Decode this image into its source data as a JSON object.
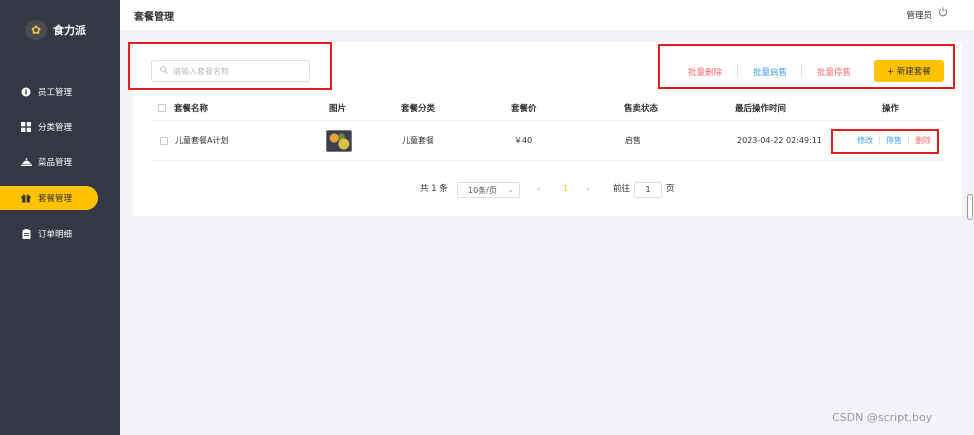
{
  "sidebar": {
    "logo_text": "食力派",
    "items": [
      {
        "label": "员工管理",
        "icon": "info-circle-icon"
      },
      {
        "label": "分类管理",
        "icon": "grid-icon"
      },
      {
        "label": "菜品管理",
        "icon": "dish-cover-icon"
      },
      {
        "label": "套餐管理",
        "icon": "gift-icon"
      },
      {
        "label": "订单明细",
        "icon": "clipboard-icon"
      }
    ],
    "active_index": 3
  },
  "header": {
    "title": "套餐管理",
    "user": "管理员"
  },
  "toolbar": {
    "search_placeholder": "请输入套餐名称",
    "batch_delete": "批量删除",
    "batch_start": "批量启售",
    "batch_stop": "批量停售",
    "new_button": "+ 新建套餐"
  },
  "table": {
    "headers": [
      "套餐名称",
      "图片",
      "套餐分类",
      "套餐价",
      "售卖状态",
      "最后操作时间",
      "操作"
    ],
    "rows": [
      {
        "name": "儿童套餐A计划",
        "category": "儿童套餐",
        "price": "￥40",
        "status": "启售",
        "updated": "2023-04-22 02:49:11",
        "ops": {
          "edit": "修改",
          "toggle": "停售",
          "delete": "删除"
        }
      }
    ]
  },
  "pagination": {
    "total": "共 1 条",
    "page_size": "10条/页",
    "current": "1",
    "goto_label": "前往",
    "goto_value": "1",
    "page_unit": "页"
  },
  "watermark": "CSDN @script.boy",
  "colors": {
    "sidebar_bg": "#343744",
    "accent": "#ffc200",
    "danger": "#f56c6c",
    "primary": "#409eff",
    "highlight_box": "#e01e1e"
  }
}
